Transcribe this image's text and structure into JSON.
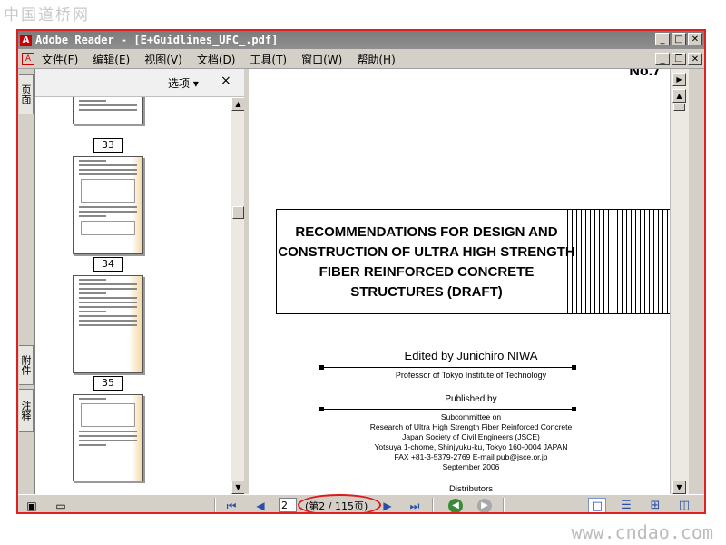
{
  "watermarks": {
    "top": "中国道桥网",
    "bottom": "www.cndao.com"
  },
  "window": {
    "title": "Adobe Reader - [E+Guidlines_UFC_.pdf]"
  },
  "menu": [
    "文件(F)",
    "编辑(E)",
    "视图(V)",
    "文档(D)",
    "工具(T)",
    "窗口(W)",
    "帮助(H)"
  ],
  "side_tabs": [
    "页面",
    "附件",
    "注释"
  ],
  "panel": {
    "options_label": "选项 ▾",
    "close": "×"
  },
  "thumbnails": [
    {
      "page": "33"
    },
    {
      "page": "34"
    },
    {
      "page": "35"
    }
  ],
  "document": {
    "corner_text": "No.7",
    "title_lines": [
      "RECOMMENDATIONS FOR DESIGN AND",
      "CONSTRUCTION OF ULTRA HIGH STRENGTH",
      "FIBER REINFORCED CONCRETE",
      "STRUCTURES (DRAFT)"
    ],
    "edited_by": "Edited by Junichiro NIWA",
    "affiliation": "Professor of Tokyo Institute of Technology",
    "published_by": "Published by",
    "publisher_lines": [
      "Subcommittee on",
      "Research of Ultra High Strength Fiber Reinforced Concrete",
      "Japan Society of Civil Engineers (JSCE)",
      "Yotsuya 1-chome, Shinjyuku-ku, Tokyo 160-0004 JAPAN",
      "FAX +81-3-5379-2769   E-mail pub@jsce.or.jp",
      "September 2006"
    ],
    "distributors": "Distributors"
  },
  "navigation": {
    "page_input": "2",
    "page_count": "(第2 / 115页)"
  }
}
